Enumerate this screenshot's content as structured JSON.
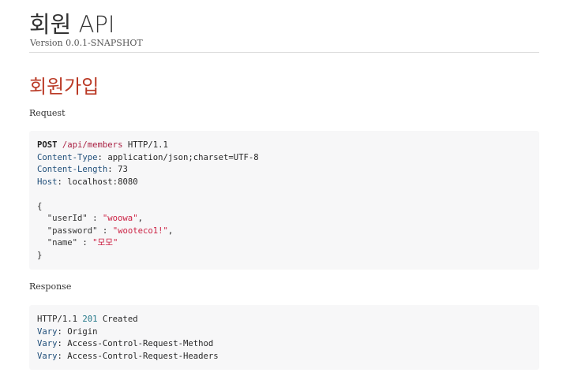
{
  "doc": {
    "title": "회원 API",
    "version": "Version 0.0.1-SNAPSHOT"
  },
  "section": {
    "title": "회원가입"
  },
  "request": {
    "label": "Request",
    "method": "POST",
    "path": "/api/members",
    "protocol": " HTTP/1.1",
    "headers": [
      {
        "name": "Content-Type",
        "value": " application/json;charset=UTF-8"
      },
      {
        "name": "Content-Length",
        "value": " 73"
      },
      {
        "name": "Host",
        "value": " localhost:8080"
      }
    ],
    "body": {
      "open": "{",
      "fields": [
        {
          "key": "  \"userId\"",
          "sep": " : ",
          "value": "\"woowa\"",
          "end": ","
        },
        {
          "key": "  \"password\"",
          "sep": " : ",
          "value": "\"wooteco1!\"",
          "end": ","
        },
        {
          "key": "  \"name\"",
          "sep": " : ",
          "value": "\"모모\"",
          "end": ""
        }
      ],
      "close": "}"
    }
  },
  "response": {
    "label": "Response",
    "protocol": "HTTP/1.1 ",
    "status_code": "201",
    "status_text": " Created",
    "headers": [
      {
        "name": "Vary",
        "value": " Origin"
      },
      {
        "name": "Vary",
        "value": " Access-Control-Request-Method"
      },
      {
        "name": "Vary",
        "value": " Access-Control-Request-Headers"
      }
    ]
  },
  "colors": {
    "section_title": "#ba3925",
    "listing_background": "#f7f7f8",
    "string_value": "#cc2244",
    "header_name": "#1f4e79",
    "status_code": "#227788"
  }
}
